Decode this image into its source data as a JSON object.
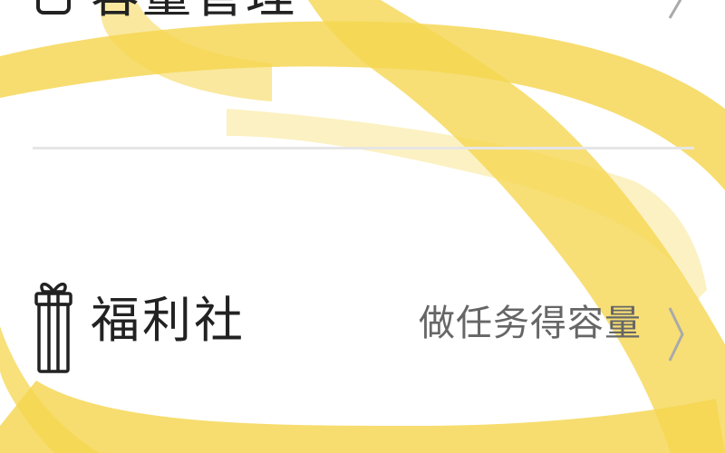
{
  "colors": {
    "highlight": "#f5d64f",
    "title_text": "#222222",
    "hint_text": "#666666",
    "divider": "#e6e6e6",
    "chevron": "#aaaaaa"
  },
  "menu": {
    "top_item": {
      "icon": "box-icon",
      "title": "容量管理",
      "hint": "",
      "chevron": "chevron-right-icon"
    },
    "welfare_item": {
      "icon": "gift-icon",
      "title": "福利社",
      "hint": "做任务得容量",
      "chevron": "chevron-right-icon"
    }
  }
}
